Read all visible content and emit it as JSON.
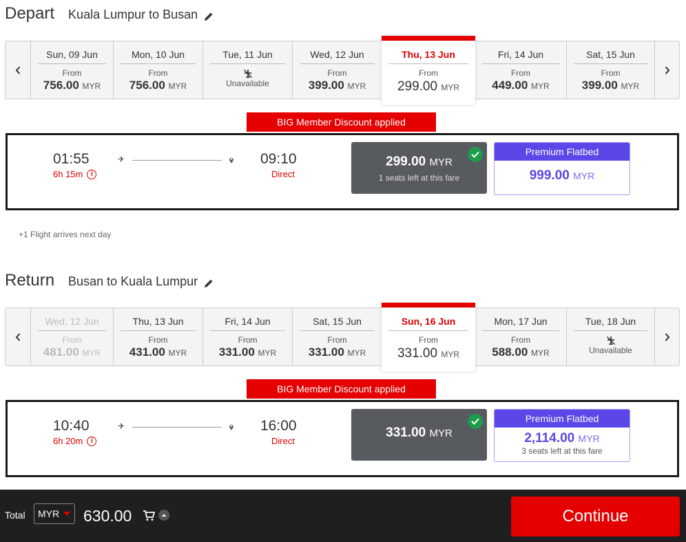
{
  "depart": {
    "title": "Depart",
    "route": "Kuala Lumpur to Busan",
    "dates": [
      {
        "label": "Sun, 09 Jun",
        "from": "From",
        "price": "756.00",
        "currency": "MYR",
        "state": "normal"
      },
      {
        "label": "Mon, 10 Jun",
        "from": "From",
        "price": "756.00",
        "currency": "MYR",
        "state": "normal"
      },
      {
        "label": "Tue, 11 Jun",
        "unavailable": "Unavailable",
        "state": "unavailable"
      },
      {
        "label": "Wed, 12 Jun",
        "from": "From",
        "price": "399.00",
        "currency": "MYR",
        "state": "normal"
      },
      {
        "label": "Thu, 13 Jun",
        "from": "From",
        "price": "299.00",
        "currency": "MYR",
        "state": "selected"
      },
      {
        "label": "Fri, 14 Jun",
        "from": "From",
        "price": "449.00",
        "currency": "MYR",
        "state": "normal"
      },
      {
        "label": "Sat, 15 Jun",
        "from": "From",
        "price": "399.00",
        "currency": "MYR",
        "state": "normal"
      }
    ],
    "discount": "BIG Member Discount applied",
    "flight": {
      "depart_time": "01:55",
      "duration": "6h 15m",
      "arrive_time": "09:10",
      "stops": "Direct",
      "std_price": "299.00",
      "std_currency": "MYR",
      "std_seats": "1 seats left at this fare",
      "premium_label": "Premium Flatbed",
      "premium_price": "999.00",
      "premium_currency": "MYR"
    },
    "note": "+1 Flight arrives next day"
  },
  "return": {
    "title": "Return",
    "route": "Busan to Kuala Lumpur",
    "dates": [
      {
        "label": "Wed, 12 Jun",
        "from": "From",
        "price": "481.00",
        "currency": "MYR",
        "state": "disabled"
      },
      {
        "label": "Thu, 13 Jun",
        "from": "From",
        "price": "431.00",
        "currency": "MYR",
        "state": "normal"
      },
      {
        "label": "Fri, 14 Jun",
        "from": "From",
        "price": "331.00",
        "currency": "MYR",
        "state": "normal"
      },
      {
        "label": "Sat, 15 Jun",
        "from": "From",
        "price": "331.00",
        "currency": "MYR",
        "state": "normal"
      },
      {
        "label": "Sun, 16 Jun",
        "from": "From",
        "price": "331.00",
        "currency": "MYR",
        "state": "selected"
      },
      {
        "label": "Mon, 17 Jun",
        "from": "From",
        "price": "588.00",
        "currency": "MYR",
        "state": "normal"
      },
      {
        "label": "Tue, 18 Jun",
        "unavailable": "Unavailable",
        "state": "unavailable"
      }
    ],
    "discount": "BIG Member Discount applied",
    "flight": {
      "depart_time": "10:40",
      "duration": "6h 20m",
      "arrive_time": "16:00",
      "stops": "Direct",
      "std_price": "331.00",
      "std_currency": "MYR",
      "premium_label": "Premium Flatbed",
      "premium_price": "2,114.00",
      "premium_currency": "MYR",
      "premium_seats": "3 seats left at this fare"
    }
  },
  "footer": {
    "total_label": "Total",
    "currency": "MYR",
    "total": "630.00",
    "continue_label": "Continue"
  },
  "icons": {
    "prev": "chevron-left-icon",
    "next": "chevron-right-icon",
    "edit": "pencil-icon",
    "plane": "plane-icon",
    "pin": "location-pin-icon",
    "check": "check-icon",
    "cart": "cart-icon",
    "info": "info-icon"
  },
  "colors": {
    "brand_red": "#e40000",
    "premium_purple": "#5b47e8",
    "std_fare_bg": "#575a5f",
    "check_green": "#1e9c4b",
    "footer_bg": "#1f1f1f"
  }
}
